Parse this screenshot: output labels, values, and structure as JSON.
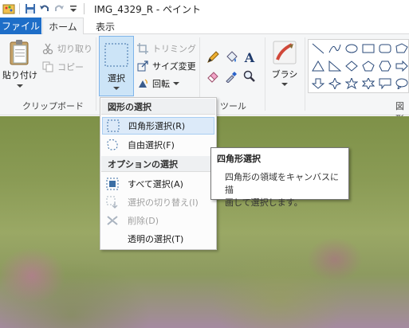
{
  "window": {
    "title": "IMG_4329_R - ペイント"
  },
  "tabs": {
    "file": "ファイル",
    "home": "ホーム",
    "view": "表示"
  },
  "ribbon": {
    "clipboard": {
      "paste": "貼り付け",
      "cut": "切り取り",
      "copy": "コピー",
      "group": "クリップボード"
    },
    "image": {
      "select": "選択",
      "crop": "トリミング",
      "resize": "サイズ変更",
      "rotate": "回転"
    },
    "tools": {
      "group": "ツール"
    },
    "brushes": {
      "label": "ブラシ"
    },
    "shapes": {
      "group": "図形"
    }
  },
  "select_menu": {
    "shape_header": "図形の選択",
    "rect": "四角形選択(R)",
    "freeform": "自由選択(F)",
    "option_header": "オプションの選択",
    "select_all": "すべて選択(A)",
    "invert": "選択の切り替え(I)",
    "delete": "削除(D)",
    "transparent": "透明の選択(T)"
  },
  "tooltip": {
    "title": "四角形選択",
    "line1": "四角形の領域をキャンバスに描",
    "line2": "画して選択します。"
  },
  "colors": {
    "file_tab": "#1e6ec8",
    "highlight": "#dceaf9",
    "accent_border": "#a8cdf2"
  }
}
